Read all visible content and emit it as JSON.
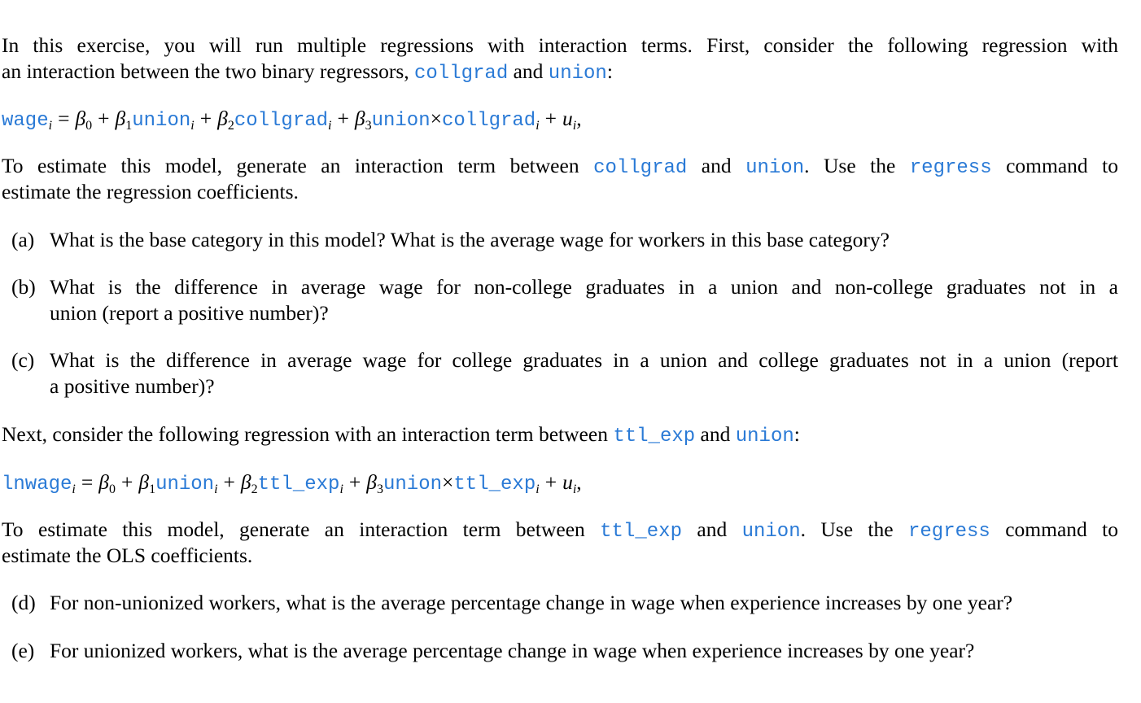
{
  "intro": {
    "line1": "In this exercise, you will run multiple regressions with interaction terms. First, consider the following regression with",
    "line2_prefix": "an interaction between the two binary regressors, ",
    "var_collgrad": "collgrad",
    "and": " and ",
    "var_union": "union",
    "line2_suffix": ":"
  },
  "equation1": {
    "lhs": "wage",
    "sub": "i",
    "eq": "=",
    "beta0": "β",
    "beta0_sub": "0",
    "plus": "+",
    "beta1": "β",
    "beta1_sub": "1",
    "term1": "union",
    "beta2": "β",
    "beta2_sub": "2",
    "term2": "collgrad",
    "beta3": "β",
    "beta3_sub": "3",
    "term3a": "union",
    "times": "×",
    "term3b": "collgrad",
    "error": "u",
    "comma": ","
  },
  "para2": {
    "line1_prefix": "To estimate this model, generate an interaction term between ",
    "var_collgrad": "collgrad",
    "and": " and ",
    "var_union": "union",
    "mid": ".  Use the ",
    "cmd_regress": "regress",
    "line1_suffix": " command to",
    "line2": "estimate the regression coefficients."
  },
  "questions_part1": [
    {
      "label": "(a)",
      "lines": [
        "What is the base category in this model? What is the average wage for workers in this base category?"
      ]
    },
    {
      "label": "(b)",
      "lines": [
        "What is the difference in average wage for non-college graduates in a union and non-college graduates not in a",
        "union (report a positive number)?"
      ]
    },
    {
      "label": "(c)",
      "lines": [
        "What is the difference in average wage for college graduates in a union and college graduates not in a union (report",
        "a positive number)?"
      ]
    }
  ],
  "para3": {
    "prefix": "Next, consider the following regression with an interaction term between ",
    "var_ttl_exp": "ttl_exp",
    "and": " and ",
    "var_union": "union",
    "suffix": ":"
  },
  "equation2": {
    "lhs": "lnwage",
    "sub": "i",
    "eq": "=",
    "beta0": "β",
    "beta0_sub": "0",
    "plus": "+",
    "beta1": "β",
    "beta1_sub": "1",
    "term1": "union",
    "beta2": "β",
    "beta2_sub": "2",
    "term2": "ttl_exp",
    "beta3": "β",
    "beta3_sub": "3",
    "term3a": "union",
    "times": "×",
    "term3b": "ttl_exp",
    "error": "u",
    "comma": ","
  },
  "para4": {
    "line1_prefix": "To estimate this model, generate an interaction term between ",
    "var_ttl_exp": "ttl_exp",
    "and": " and ",
    "var_union": "union",
    "mid": ".  Use the ",
    "cmd_regress": "regress",
    "line1_suffix": " command to",
    "line2": "estimate the OLS coefficients."
  },
  "questions_part2": [
    {
      "label": "(d)",
      "lines": [
        "For non-unionized workers, what is the average percentage change in wage when experience increases by one year?"
      ]
    },
    {
      "label": "(e)",
      "lines": [
        "For unionized workers, what is the average percentage change in wage when experience increases by one year?"
      ]
    }
  ],
  "colors": {
    "code": "#2a7ad6",
    "text": "#000000",
    "background": "#ffffff"
  }
}
